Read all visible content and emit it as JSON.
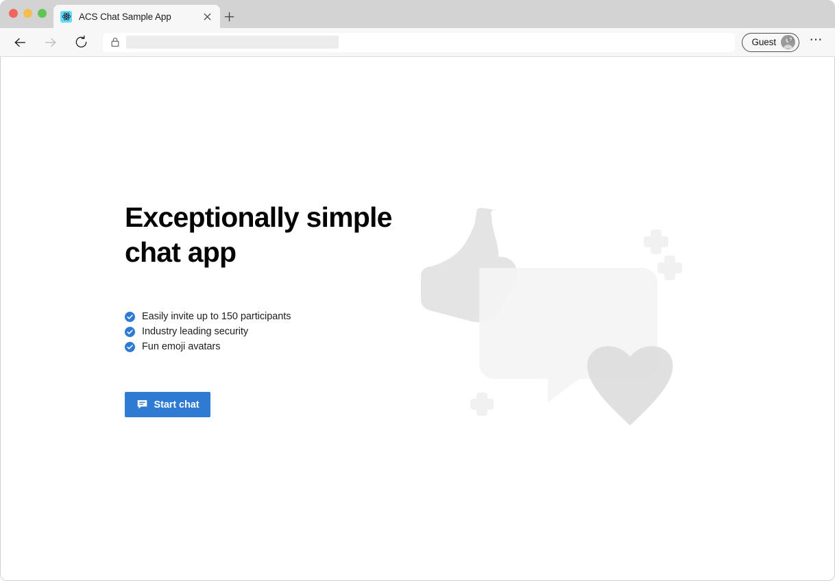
{
  "window": {
    "traffic_lights": [
      {
        "name": "close",
        "color": "#f0665e"
      },
      {
        "name": "minimize",
        "color": "#f5bd4f"
      },
      {
        "name": "maximize",
        "color": "#61c554"
      }
    ]
  },
  "tab_strip": {
    "active_tab": {
      "title": "ACS Chat Sample App",
      "favicon": "react-logo-icon",
      "close_icon": "close-icon"
    },
    "new_tab_icon": "plus-icon"
  },
  "toolbar": {
    "back_icon": "back-arrow-icon",
    "forward_icon": "forward-arrow-icon",
    "reload_icon": "reload-icon",
    "address_bar": {
      "lock_icon": "lock-icon",
      "value": "",
      "placeholder": "",
      "redacted": true
    },
    "profile": {
      "label": "Guest",
      "avatar_icon": "guest-avatar-icon"
    },
    "menu_icon": "ellipsis-icon"
  },
  "page": {
    "hero": {
      "title_line1": "Exceptionally simple",
      "title_line2": "chat app"
    },
    "features": [
      {
        "icon": "check-circle-icon",
        "label": "Easily invite up to 150 participants"
      },
      {
        "icon": "check-circle-icon",
        "label": "Industry leading security"
      },
      {
        "icon": "check-circle-icon",
        "label": "Fun emoji avatars"
      }
    ],
    "primary_action": {
      "label": "Start chat",
      "icon": "chat-bubble-icon",
      "color": "#2f7bd3"
    },
    "illustration": {
      "name": "chat-hero-illustration",
      "shapes": [
        "thumbs-up",
        "speech-bubble",
        "heart",
        "sparkle-plus",
        "sparkle-plus",
        "sparkle-plus"
      ],
      "colors": {
        "thumbs_up": "#e4e4e4",
        "speech_bubble": "#f4f4f4",
        "heart": "#e2e2e2",
        "sparkle": "#f1f1f1"
      }
    }
  },
  "theme": {
    "accent": "#2f7bd3",
    "page_background": "#ffffff",
    "chrome_background": "#f7f7f7",
    "tabstrip_background": "#d3d3d3"
  }
}
